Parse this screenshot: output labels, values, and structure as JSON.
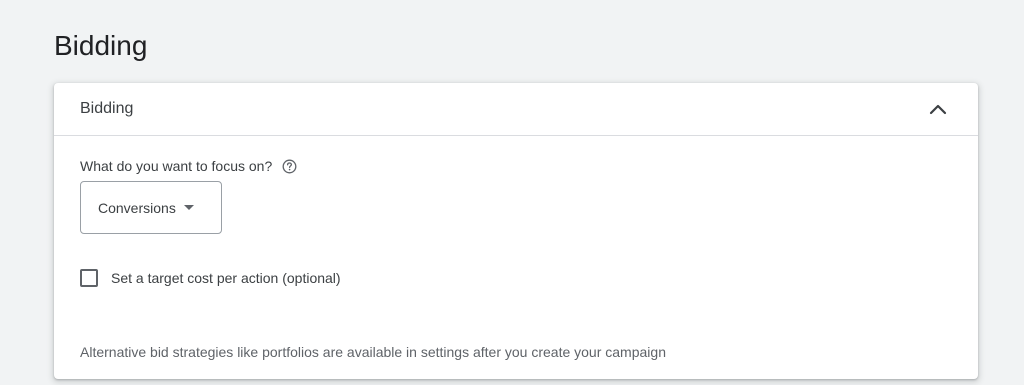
{
  "page": {
    "title": "Bidding"
  },
  "panel": {
    "header_title": "Bidding",
    "collapse_icon": "chevron-up-icon",
    "focus_question": "What do you want to focus on?",
    "help_icon": "help-circle-icon",
    "focus_dropdown": {
      "selected": "Conversions",
      "icon": "caret-down-icon"
    },
    "target_cpa_checkbox": {
      "label": "Set a target cost per action (optional)",
      "checked": false
    },
    "footnote": "Alternative bid strategies like portfolios are available in settings after you create your campaign"
  },
  "colors": {
    "background": "#f1f3f4",
    "panel": "#ffffff",
    "text_primary": "#202124",
    "text_secondary": "#5f6368",
    "border": "#dadce0"
  }
}
